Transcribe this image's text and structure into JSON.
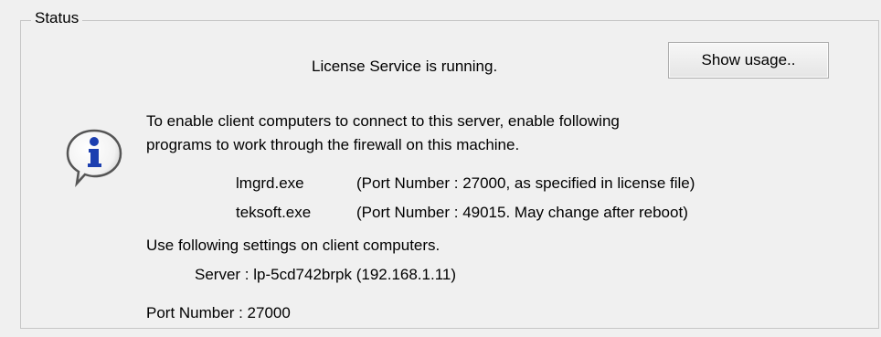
{
  "group": {
    "legend": "Status"
  },
  "service": {
    "status_text": "License Service is running.",
    "show_usage_label": "Show usage.."
  },
  "icon": "info-icon",
  "firewall": {
    "line1": "To enable client computers to connect to this server, enable following",
    "line2": "programs to work through the firewall on this machine.",
    "programs": [
      {
        "name": "lmgrd.exe",
        "note": "(Port Number : 27000, as specified in license file)"
      },
      {
        "name": "teksoft.exe",
        "note": "(Port Number : 49015. May change after reboot)"
      }
    ]
  },
  "client": {
    "heading": "Use following settings on client computers.",
    "server_line": "Server :  lp-5cd742brpk (192.168.1.11)",
    "port_line": "Port Number :  27000"
  }
}
